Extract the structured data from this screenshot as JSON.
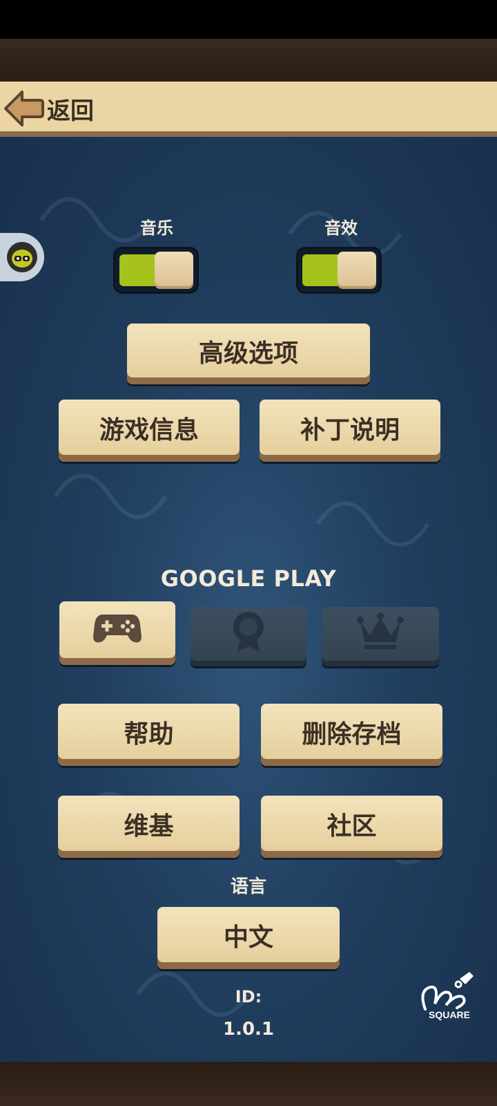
{
  "header": {
    "back_label": "返回"
  },
  "toggles": {
    "music": {
      "label": "音乐",
      "on": true
    },
    "sfx": {
      "label": "音效",
      "on": true
    }
  },
  "buttons": {
    "advanced": "高级选项",
    "game_info": "游戏信息",
    "patch_notes": "补丁说明",
    "help": "帮助",
    "delete_save": "删除存档",
    "wiki": "维基",
    "community": "社区"
  },
  "google_play": {
    "title": "GOOGLE PLAY",
    "items": [
      {
        "icon": "gamepad-icon",
        "enabled": true
      },
      {
        "icon": "achievement-badge-icon",
        "enabled": false
      },
      {
        "icon": "leaderboard-crown-icon",
        "enabled": false
      }
    ]
  },
  "language": {
    "label": "语言",
    "value": "中文"
  },
  "footer": {
    "id_label": "ID:",
    "version": "1.0.1",
    "brand": "SQUARE"
  },
  "colors": {
    "panel": "#213e5e",
    "button": "#ebd6a3",
    "toggle_on": "#a6c21c",
    "text_dark": "#3c2f24",
    "text_light": "#f3ead9"
  }
}
